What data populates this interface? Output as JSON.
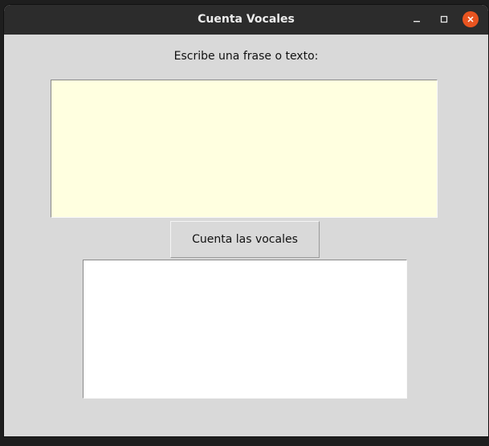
{
  "window": {
    "title": "Cuenta Vocales",
    "controls": {
      "minimize_icon": "minimize-icon",
      "maximize_icon": "maximize-icon",
      "close_icon": "close-icon"
    },
    "colors": {
      "titlebar": "#2c2c2c",
      "body": "#d9d9d9",
      "close_accent": "#e95420"
    }
  },
  "main": {
    "prompt_label": "Escribe una frase o texto:",
    "input": {
      "value": "",
      "background": "#ffffe0"
    },
    "count_button_label": "Cuenta las vocales",
    "result": {
      "value": "",
      "background": "#ffffff"
    }
  }
}
